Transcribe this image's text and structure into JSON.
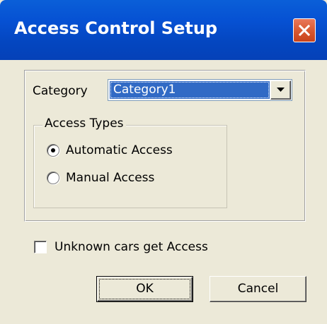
{
  "window": {
    "title": "Access Control Setup",
    "titlebar_color": "#0651d3",
    "close_button_color": "#d95a32"
  },
  "category": {
    "label": "Category",
    "selected_value": "Category1"
  },
  "access_types": {
    "group_title": "Access Types",
    "options": [
      {
        "label": "Automatic Access",
        "checked": true
      },
      {
        "label": "Manual Access",
        "checked": false
      }
    ]
  },
  "unknown_cars": {
    "label": "Unknown cars get Access",
    "checked": false
  },
  "buttons": {
    "ok_label": "OK",
    "cancel_label": "Cancel"
  },
  "icons": {
    "close": "close-icon",
    "dropdown": "chevron-down-icon"
  }
}
